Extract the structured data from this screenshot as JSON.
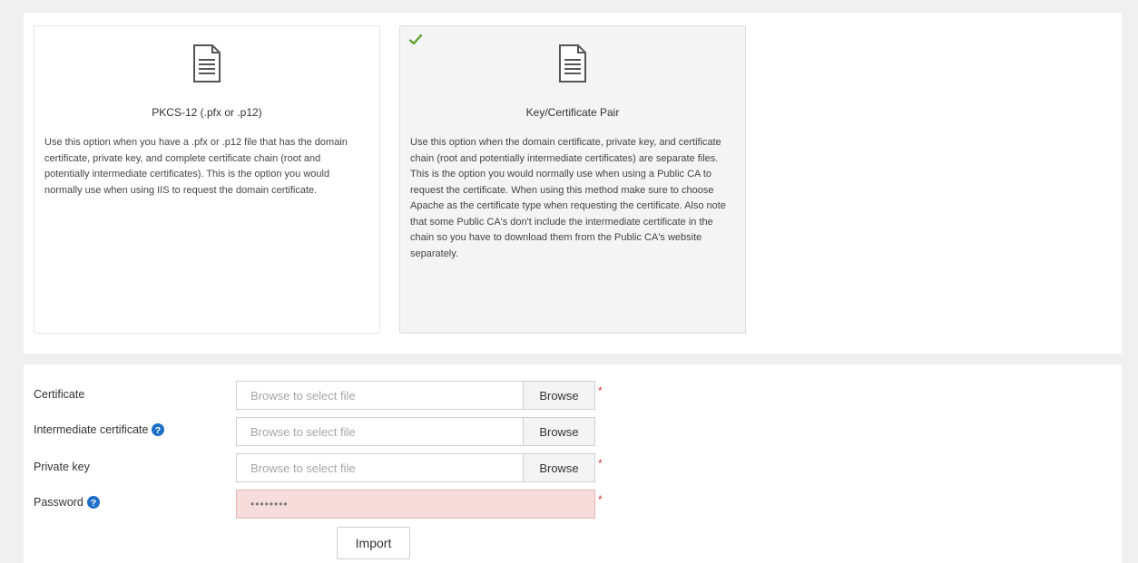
{
  "colors": {
    "check": "#5a9e2a",
    "help": "#1e6fc7",
    "required": "#dd3333",
    "password_bg": "#f7dcdc"
  },
  "options": [
    {
      "title": "PKCS-12 (.pfx or .p12)",
      "icon": "document-icon",
      "selected": false,
      "description": "Use this option when you have a .pfx or .p12 file that has the domain certificate, private key, and complete certificate chain (root and potentially intermediate certificates). This is the option you would normally use when using IIS to request the domain certificate."
    },
    {
      "title": "Key/Certificate Pair",
      "icon": "document-icon",
      "selected": true,
      "description": "Use this option when the domain certificate, private key, and certificate chain (root and potentially intermediate certificates) are separate files. This is the option you would normally use when using a Public CA to request the certificate. When using this method make sure to choose Apache as the certificate type when requesting the certificate. Also note that some Public CA's don't include the intermediate certificate in the chain so you have to download them from the Public CA's website separately."
    }
  ],
  "form": {
    "certificate": {
      "label": "Certificate",
      "placeholder": "Browse to select file",
      "browse": "Browse",
      "required": "*"
    },
    "intermediate": {
      "label": "Intermediate certificate",
      "placeholder": "Browse to select file",
      "browse": "Browse",
      "help_icon": "help-icon"
    },
    "private_key": {
      "label": "Private key",
      "placeholder": "Browse to select file",
      "browse": "Browse",
      "required": "*"
    },
    "password": {
      "label": "Password",
      "value": "••••••••",
      "help_icon": "help-icon",
      "required": "*"
    },
    "import_label": "Import"
  }
}
